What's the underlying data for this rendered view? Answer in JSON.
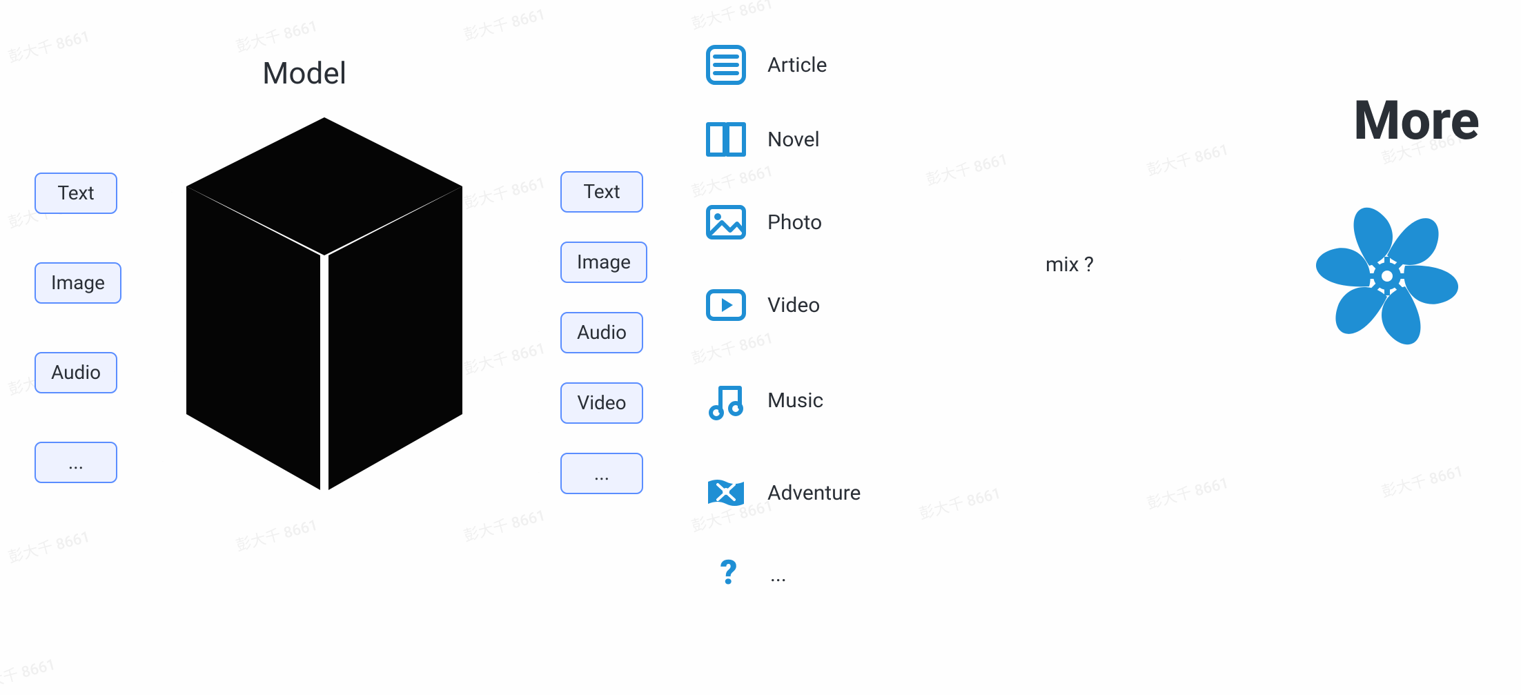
{
  "watermark": "彭大千 8661",
  "title": "Model",
  "inputs": [
    {
      "label": "Text"
    },
    {
      "label": "Image"
    },
    {
      "label": "Audio"
    },
    {
      "label": "..."
    }
  ],
  "outputs": [
    {
      "label": "Text"
    },
    {
      "label": "Image"
    },
    {
      "label": "Audio"
    },
    {
      "label": "Video"
    },
    {
      "label": "..."
    }
  ],
  "media": [
    {
      "icon": "article-icon",
      "label": "Article"
    },
    {
      "icon": "novel-icon",
      "label": "Novel"
    },
    {
      "icon": "photo-icon",
      "label": "Photo"
    },
    {
      "icon": "video-icon",
      "label": "Video"
    },
    {
      "icon": "music-icon",
      "label": "Music"
    },
    {
      "icon": "adventure-icon",
      "label": "Adventure"
    },
    {
      "icon": "question-icon",
      "label": "..."
    }
  ],
  "mix_label": "mix ?",
  "more_title": "More",
  "colors": {
    "accent": "#1f8fd4",
    "pill_border": "#5a8dff",
    "pill_bg": "#eef2ff",
    "arrow": "#aab1bb",
    "text": "#2a2f36"
  }
}
